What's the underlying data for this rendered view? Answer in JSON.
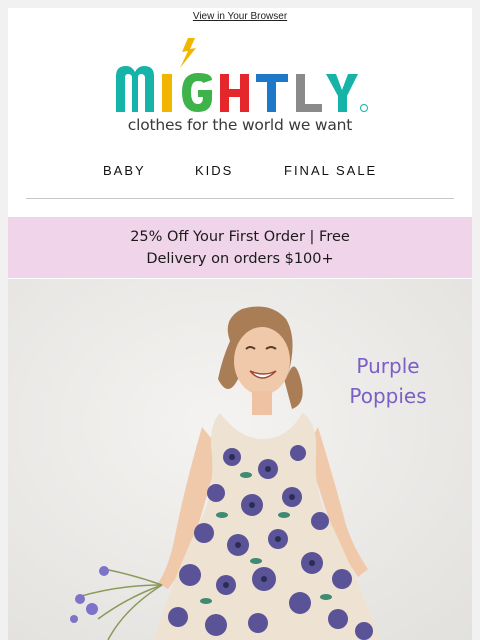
{
  "header": {
    "view_in_browser": "View in Your Browser"
  },
  "brand": {
    "logo_text": "MIGHTLY",
    "tagline": "clothes for the world we want",
    "colors": {
      "teal": "#15b3a8",
      "yellow": "#f2b500",
      "green": "#3db34a",
      "red": "#e5262b",
      "blue": "#1e78c8",
      "gray": "#8a8a8a",
      "lightning": "#f2b500"
    }
  },
  "nav": {
    "items": [
      "BABY",
      "KIDS",
      "FINAL SALE"
    ]
  },
  "promo": {
    "line1": "25% Off Your First Order | Free",
    "line2": "Delivery on orders $100+",
    "background": "#f0d4ea"
  },
  "hero": {
    "title_line1": "Purple",
    "title_line2": "Poppies",
    "title_color": "#7a5fc4"
  }
}
